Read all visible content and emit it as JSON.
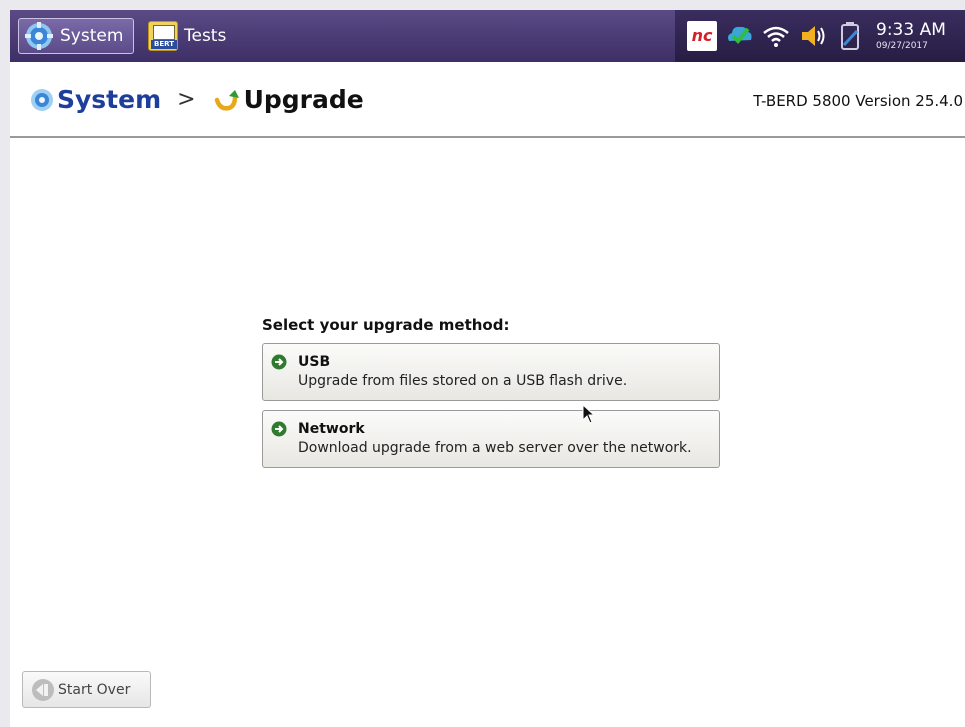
{
  "topbar": {
    "tabs": [
      {
        "label": "System",
        "icon": "gear-icon"
      },
      {
        "label": "Tests",
        "icon": "bert-icon",
        "icon_text": "BERT"
      }
    ],
    "status_icons": [
      "nc-icon",
      "cloud-check-icon",
      "wifi-icon",
      "speaker-icon",
      "battery-icon"
    ],
    "nc_icon_text": "nc",
    "time": "9:33 AM",
    "date": "09/27/2017"
  },
  "header": {
    "breadcrumb": {
      "root": "System",
      "separator": ">",
      "current": "Upgrade"
    },
    "version": "T-BERD 5800 Version 25.4.0"
  },
  "main": {
    "prompt": "Select your upgrade method:",
    "methods": [
      {
        "title": "USB",
        "description": "Upgrade from files stored on a USB flash drive."
      },
      {
        "title": "Network",
        "description": "Download upgrade from a web server over the network."
      }
    ]
  },
  "footer": {
    "start_over_label": "Start Over"
  },
  "colors": {
    "topbar": "#4b3c78",
    "breadcrumb_root": "#1d3e9a",
    "arrow_icon": "#2f8a2f",
    "upgrade_icon": "#e7a81a"
  }
}
